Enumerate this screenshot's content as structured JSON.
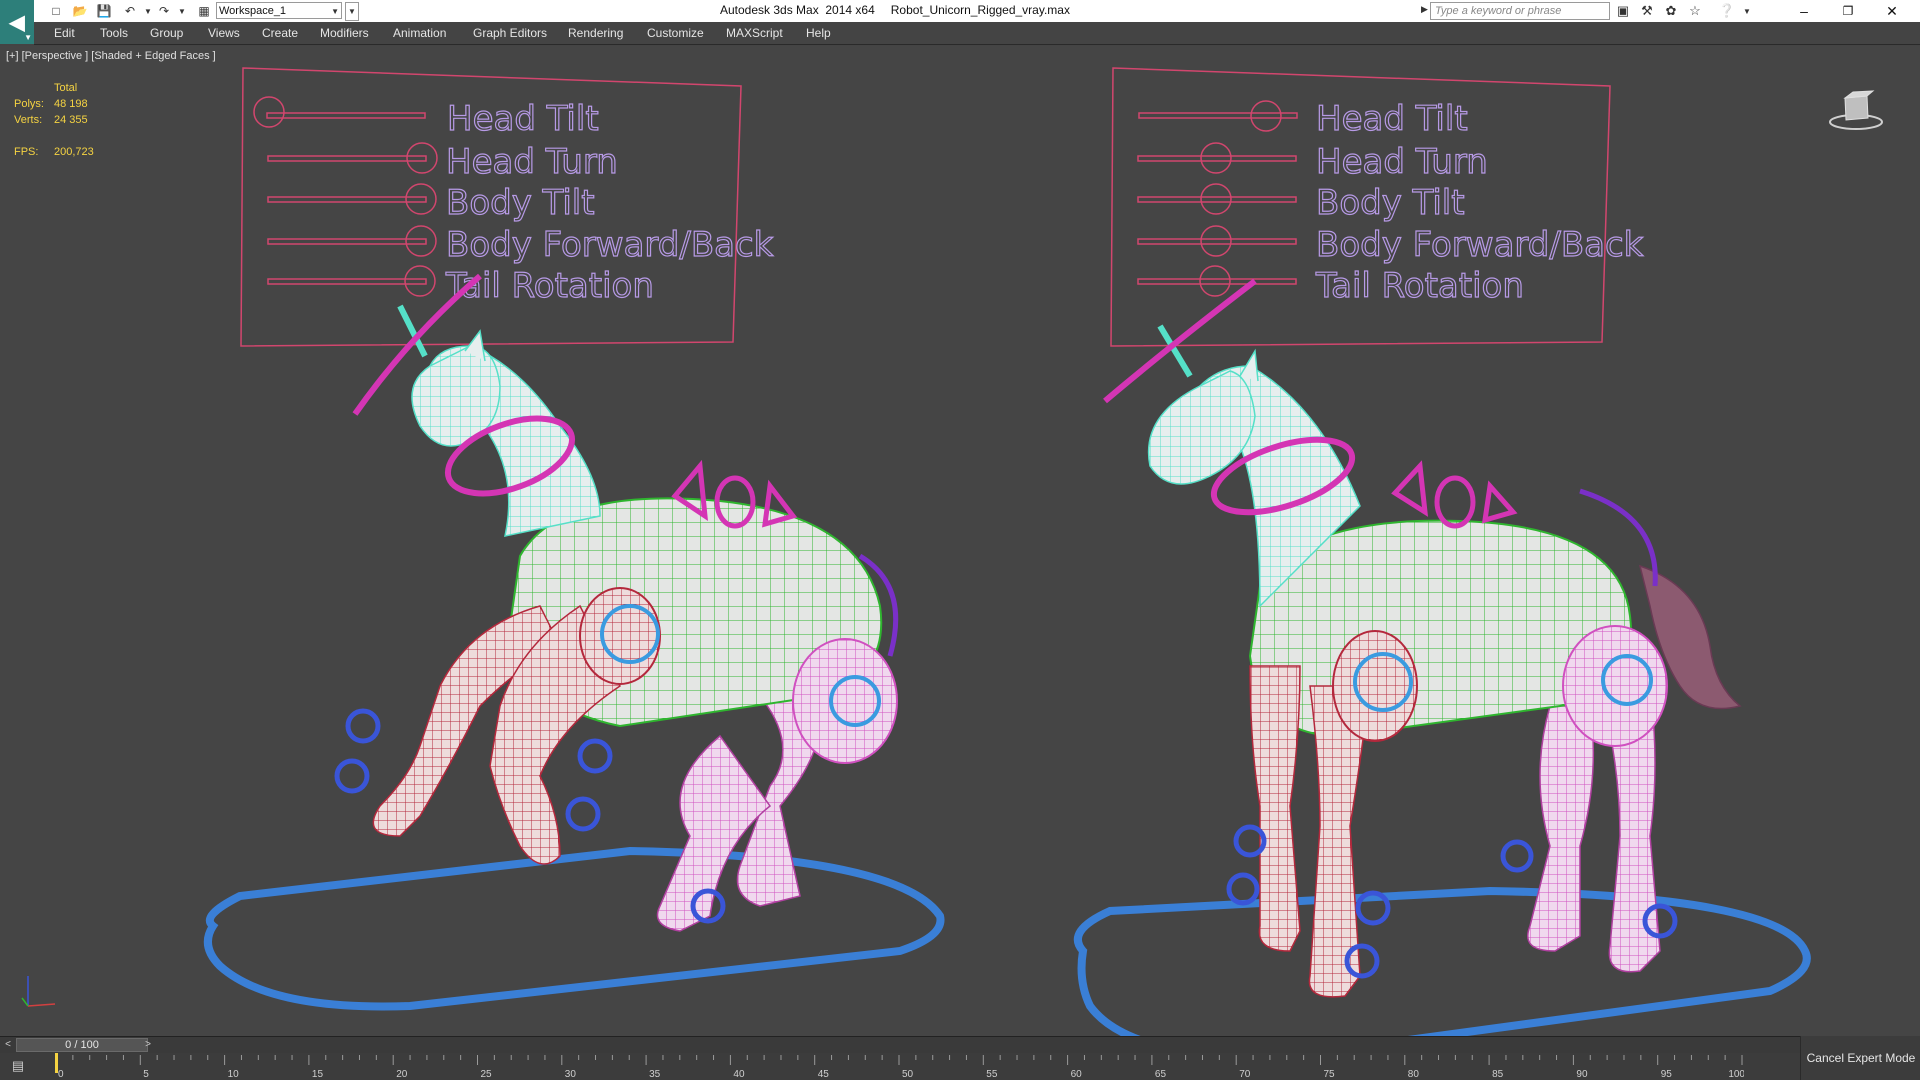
{
  "titlebar": {
    "workspace": "Workspace_1",
    "app_name": "Autodesk 3ds Max  2014 x64",
    "file_name": "Robot_Unicorn_Rigged_vray.max",
    "search_placeholder": "Type a keyword or phrase"
  },
  "menu": [
    "Edit",
    "Tools",
    "Group",
    "Views",
    "Create",
    "Modifiers",
    "Animation",
    "Graph Editors",
    "Rendering",
    "Customize",
    "MAXScript",
    "Help"
  ],
  "viewport": {
    "label": "[+] [Perspective ] [Shaded + Edged Faces ]",
    "stats": {
      "header": "Total",
      "polys_label": "Polys:",
      "polys": "48 198",
      "verts_label": "Verts:",
      "verts": "24 355",
      "fps_label": "FPS:",
      "fps": "200,723"
    },
    "rig_panels": [
      {
        "sliders": [
          "Head Tilt",
          "Head Turn",
          "Body Tilt",
          "Body Forward/Back",
          "Tail Rotation"
        ]
      },
      {
        "sliders": [
          "Head Tilt",
          "Head Turn",
          "Body Tilt",
          "Body Forward/Back",
          "Tail Rotation"
        ]
      }
    ]
  },
  "timeline": {
    "frame_display": "0 / 100",
    "ticks": [
      "0",
      "5",
      "10",
      "15",
      "20",
      "25",
      "30",
      "35",
      "40",
      "45",
      "50",
      "55",
      "60",
      "65",
      "70",
      "75",
      "80",
      "85",
      "90",
      "95",
      "100"
    ],
    "cancel_expert": "Cancel Expert Mode"
  },
  "colors": {
    "panel_frame": "#d2466e",
    "slider_text": "#b79ae6",
    "mesh_cyan": "#7ff0d8",
    "mesh_green": "#2fb52f",
    "mesh_red": "#b4283c",
    "mesh_pink": "#e060c8",
    "control_magenta": "#d435b4",
    "control_blue": "#3a55d8",
    "base_blue": "#3a7fd6"
  }
}
